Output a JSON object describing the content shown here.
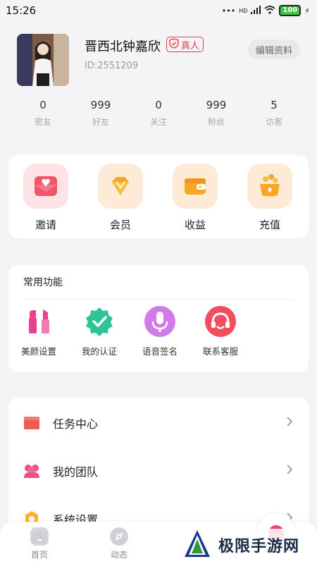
{
  "status_bar": {
    "time": "15:26",
    "signal": "HD",
    "battery": "100"
  },
  "profile": {
    "nickname": "晋西北钟嘉欣",
    "verified_badge": "真人",
    "user_id": "ID:2551209",
    "edit_button": "编辑资料"
  },
  "stats": [
    {
      "value": "0",
      "label": "密友"
    },
    {
      "value": "999",
      "label": "好友"
    },
    {
      "value": "0",
      "label": "关注"
    },
    {
      "value": "999",
      "label": "粉丝"
    },
    {
      "value": "5",
      "label": "访客"
    }
  ],
  "main_actions": [
    {
      "label": "邀请",
      "icon": "envelope-heart-icon",
      "bg": "#fde3e6",
      "color": "#f0566a"
    },
    {
      "label": "会员",
      "icon": "diamond-icon",
      "bg": "#fdebd7",
      "color": "#f7a823"
    },
    {
      "label": "收益",
      "icon": "wallet-icon",
      "bg": "#fdebd7",
      "color": "#f7a823"
    },
    {
      "label": "充值",
      "icon": "coin-pot-icon",
      "bg": "#fdebd7",
      "color": "#f7a823"
    }
  ],
  "common": {
    "title": "常用功能",
    "items": [
      {
        "label": "美颜设置",
        "icon": "lipstick-icon",
        "color": "#ea3f8f"
      },
      {
        "label": "我的认证",
        "icon": "verified-check-icon",
        "color": "#2fc497"
      },
      {
        "label": "语音签名",
        "icon": "microphone-icon",
        "color": "#d07be9"
      },
      {
        "label": "联系客服",
        "icon": "headset-icon",
        "color": "#f04e5e"
      }
    ]
  },
  "list": [
    {
      "label": "任务中心",
      "icon": "flag-icon",
      "color": "#f05a54"
    },
    {
      "label": "我的团队",
      "icon": "team-icon",
      "color": "#ee4e8a"
    },
    {
      "label": "系统设置",
      "icon": "settings-icon",
      "color": "#f5b52a"
    }
  ],
  "tabbar": [
    {
      "label": "首页",
      "icon": "home-icon"
    },
    {
      "label": "动态",
      "icon": "compass-icon"
    }
  ],
  "watermark": {
    "text": "极限手游网"
  }
}
